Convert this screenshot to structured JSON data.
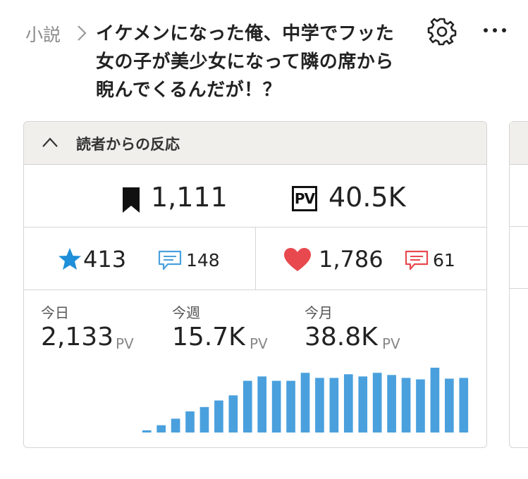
{
  "breadcrumb": {
    "category": "小説"
  },
  "work": {
    "title": "イケメンになった俺、中学でフッた女の子が美少女になって隣の席から睨んでくるんだが！？"
  },
  "icons": {
    "settings": "gear-icon",
    "more": "more-icon"
  },
  "reactions": {
    "header_label": "読者からの反応",
    "bookmarks": "1,111",
    "pv_badge": "PV",
    "pv_total": "40.5K",
    "stars": "413",
    "star_comments": "148",
    "hearts": "1,786",
    "heart_comments": "61",
    "stats": [
      {
        "label": "今日",
        "value": "2,133",
        "unit": "PV"
      },
      {
        "label": "今週",
        "value": "15.7K",
        "unit": "PV"
      },
      {
        "label": "今月",
        "value": "38.8K",
        "unit": "PV"
      }
    ]
  },
  "colors": {
    "accent_blue": "#4aa0dd",
    "star_blue": "#1e8fd8",
    "heart_red": "#e8494f",
    "header_bg": "#f0efec"
  },
  "chart_data": {
    "type": "bar",
    "values": [
      3,
      10,
      19,
      29,
      35,
      44,
      51,
      71,
      77,
      71,
      71,
      82,
      75,
      75,
      80,
      77,
      82,
      79,
      75,
      73,
      89,
      74,
      75
    ]
  }
}
